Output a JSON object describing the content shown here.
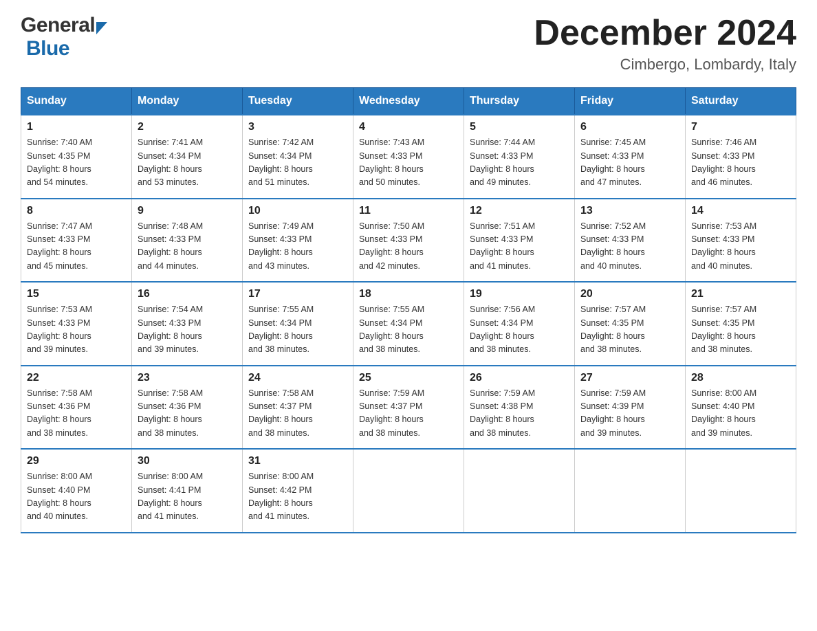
{
  "header": {
    "logo_general": "General",
    "logo_blue": "Blue",
    "month_year": "December 2024",
    "location": "Cimbergo, Lombardy, Italy"
  },
  "days_of_week": [
    "Sunday",
    "Monday",
    "Tuesday",
    "Wednesday",
    "Thursday",
    "Friday",
    "Saturday"
  ],
  "weeks": [
    [
      {
        "day": "1",
        "sunrise": "7:40 AM",
        "sunset": "4:35 PM",
        "daylight": "8 hours and 54 minutes."
      },
      {
        "day": "2",
        "sunrise": "7:41 AM",
        "sunset": "4:34 PM",
        "daylight": "8 hours and 53 minutes."
      },
      {
        "day": "3",
        "sunrise": "7:42 AM",
        "sunset": "4:34 PM",
        "daylight": "8 hours and 51 minutes."
      },
      {
        "day": "4",
        "sunrise": "7:43 AM",
        "sunset": "4:33 PM",
        "daylight": "8 hours and 50 minutes."
      },
      {
        "day": "5",
        "sunrise": "7:44 AM",
        "sunset": "4:33 PM",
        "daylight": "8 hours and 49 minutes."
      },
      {
        "day": "6",
        "sunrise": "7:45 AM",
        "sunset": "4:33 PM",
        "daylight": "8 hours and 47 minutes."
      },
      {
        "day": "7",
        "sunrise": "7:46 AM",
        "sunset": "4:33 PM",
        "daylight": "8 hours and 46 minutes."
      }
    ],
    [
      {
        "day": "8",
        "sunrise": "7:47 AM",
        "sunset": "4:33 PM",
        "daylight": "8 hours and 45 minutes."
      },
      {
        "day": "9",
        "sunrise": "7:48 AM",
        "sunset": "4:33 PM",
        "daylight": "8 hours and 44 minutes."
      },
      {
        "day": "10",
        "sunrise": "7:49 AM",
        "sunset": "4:33 PM",
        "daylight": "8 hours and 43 minutes."
      },
      {
        "day": "11",
        "sunrise": "7:50 AM",
        "sunset": "4:33 PM",
        "daylight": "8 hours and 42 minutes."
      },
      {
        "day": "12",
        "sunrise": "7:51 AM",
        "sunset": "4:33 PM",
        "daylight": "8 hours and 41 minutes."
      },
      {
        "day": "13",
        "sunrise": "7:52 AM",
        "sunset": "4:33 PM",
        "daylight": "8 hours and 40 minutes."
      },
      {
        "day": "14",
        "sunrise": "7:53 AM",
        "sunset": "4:33 PM",
        "daylight": "8 hours and 40 minutes."
      }
    ],
    [
      {
        "day": "15",
        "sunrise": "7:53 AM",
        "sunset": "4:33 PM",
        "daylight": "8 hours and 39 minutes."
      },
      {
        "day": "16",
        "sunrise": "7:54 AM",
        "sunset": "4:33 PM",
        "daylight": "8 hours and 39 minutes."
      },
      {
        "day": "17",
        "sunrise": "7:55 AM",
        "sunset": "4:34 PM",
        "daylight": "8 hours and 38 minutes."
      },
      {
        "day": "18",
        "sunrise": "7:55 AM",
        "sunset": "4:34 PM",
        "daylight": "8 hours and 38 minutes."
      },
      {
        "day": "19",
        "sunrise": "7:56 AM",
        "sunset": "4:34 PM",
        "daylight": "8 hours and 38 minutes."
      },
      {
        "day": "20",
        "sunrise": "7:57 AM",
        "sunset": "4:35 PM",
        "daylight": "8 hours and 38 minutes."
      },
      {
        "day": "21",
        "sunrise": "7:57 AM",
        "sunset": "4:35 PM",
        "daylight": "8 hours and 38 minutes."
      }
    ],
    [
      {
        "day": "22",
        "sunrise": "7:58 AM",
        "sunset": "4:36 PM",
        "daylight": "8 hours and 38 minutes."
      },
      {
        "day": "23",
        "sunrise": "7:58 AM",
        "sunset": "4:36 PM",
        "daylight": "8 hours and 38 minutes."
      },
      {
        "day": "24",
        "sunrise": "7:58 AM",
        "sunset": "4:37 PM",
        "daylight": "8 hours and 38 minutes."
      },
      {
        "day": "25",
        "sunrise": "7:59 AM",
        "sunset": "4:37 PM",
        "daylight": "8 hours and 38 minutes."
      },
      {
        "day": "26",
        "sunrise": "7:59 AM",
        "sunset": "4:38 PM",
        "daylight": "8 hours and 38 minutes."
      },
      {
        "day": "27",
        "sunrise": "7:59 AM",
        "sunset": "4:39 PM",
        "daylight": "8 hours and 39 minutes."
      },
      {
        "day": "28",
        "sunrise": "8:00 AM",
        "sunset": "4:40 PM",
        "daylight": "8 hours and 39 minutes."
      }
    ],
    [
      {
        "day": "29",
        "sunrise": "8:00 AM",
        "sunset": "4:40 PM",
        "daylight": "8 hours and 40 minutes."
      },
      {
        "day": "30",
        "sunrise": "8:00 AM",
        "sunset": "4:41 PM",
        "daylight": "8 hours and 41 minutes."
      },
      {
        "day": "31",
        "sunrise": "8:00 AM",
        "sunset": "4:42 PM",
        "daylight": "8 hours and 41 minutes."
      },
      null,
      null,
      null,
      null
    ]
  ],
  "labels": {
    "sunrise": "Sunrise:",
    "sunset": "Sunset:",
    "daylight": "Daylight:"
  }
}
